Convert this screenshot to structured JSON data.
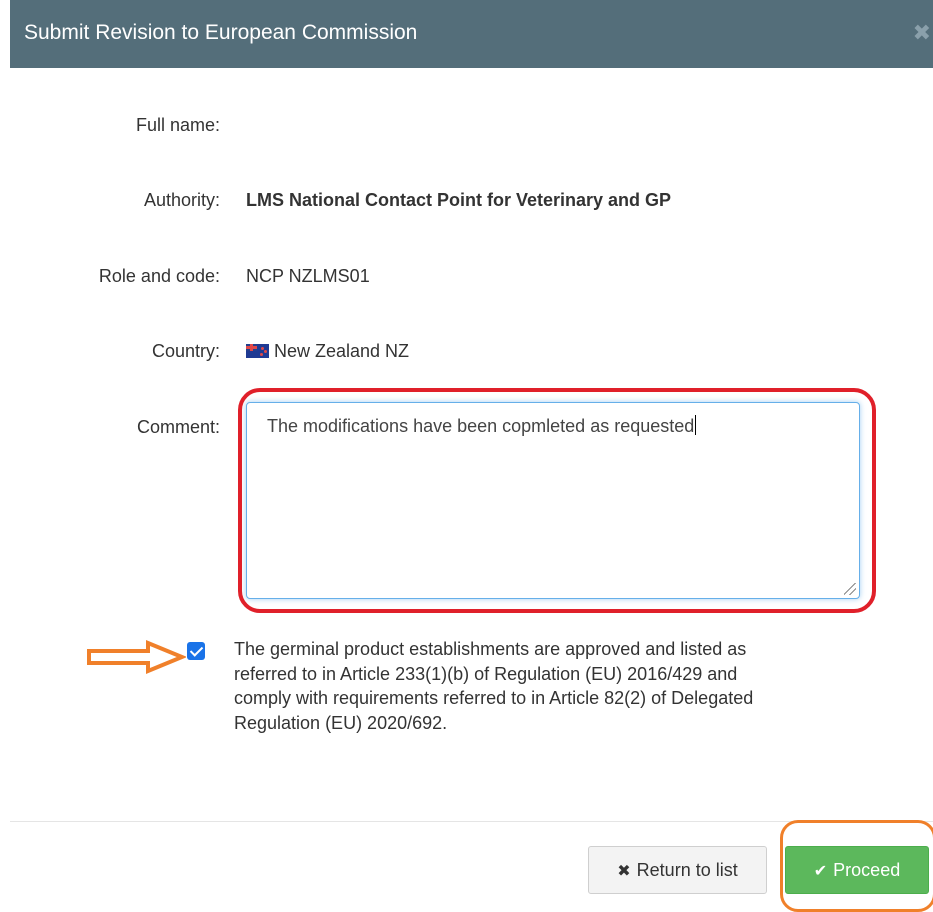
{
  "dialog": {
    "title": "Submit Revision to European Commission",
    "close_icon": "close-icon"
  },
  "form": {
    "full_name_label": "Full name:",
    "full_name_value": "",
    "authority_label": "Authority:",
    "authority_value": "LMS National Contact Point for Veterinary and GP",
    "role_label": "Role and code:",
    "role_value": "NCP NZLMS01",
    "country_label": "Country:",
    "country_value": "New Zealand NZ",
    "country_flag_icon": "new-zealand-flag-icon",
    "comment_label": "Comment:",
    "comment_value": "The modifications have been copmleted as requested"
  },
  "consent": {
    "checked": true,
    "lines": [
      "The germinal product establishments are approved and listed as",
      "referred to in Article 233(1)(b) of Regulation (EU) 2016/429 and",
      "comply with requirements referred to in Article 82(2) of Delegated",
      "Regulation (EU) 2020/692."
    ]
  },
  "footer": {
    "return_label": "Return to list",
    "return_icon": "times-icon",
    "proceed_label": "Proceed",
    "proceed_icon": "check-icon"
  },
  "colors": {
    "header_bg": "#546e7a",
    "proceed_bg": "#5cb85c",
    "annotation_red": "#e0202a",
    "annotation_orange": "#f0802a",
    "checkbox_blue": "#1a73e8"
  }
}
